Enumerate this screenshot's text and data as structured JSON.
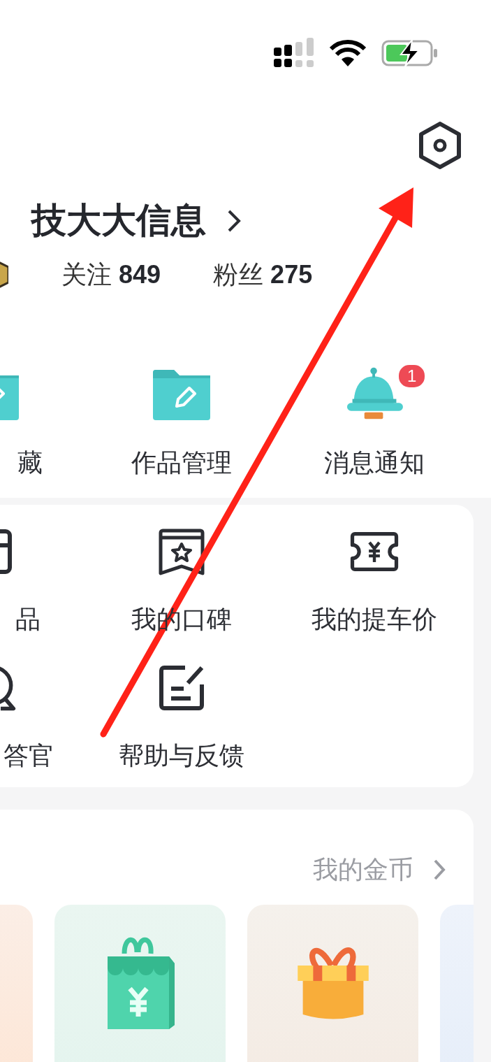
{
  "profile": {
    "name": "技大大信息",
    "stats": [
      {
        "label": "关注",
        "value": "849"
      },
      {
        "label": "粉丝",
        "value": "275"
      }
    ]
  },
  "shortcuts": [
    {
      "label": "藏",
      "kind": "folder-star"
    },
    {
      "label": "作品管理",
      "kind": "folder-pencil"
    },
    {
      "label": "消息通知",
      "kind": "bell",
      "badge": "1"
    }
  ],
  "services": [
    {
      "label": "品",
      "kind": "gift-box"
    },
    {
      "label": "我的口碑",
      "kind": "review"
    },
    {
      "label": "我的提车价",
      "kind": "ticket"
    },
    {
      "label": "答官",
      "kind": "chat"
    },
    {
      "label": "帮助与反馈",
      "kind": "feedback"
    }
  ],
  "coins": {
    "link": "我的金币",
    "tiles": [
      {
        "kind": "peach"
      },
      {
        "kind": "shop-bag"
      },
      {
        "kind": "gift"
      },
      {
        "kind": "blue"
      }
    ]
  }
}
